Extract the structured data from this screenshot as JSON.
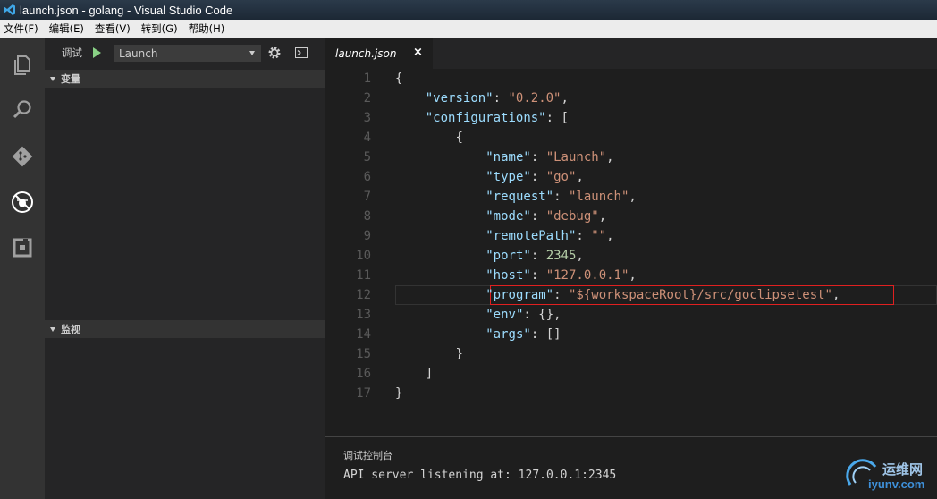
{
  "window": {
    "title": "launch.json - golang - Visual Studio Code"
  },
  "menu": [
    "文件(F)",
    "编辑(E)",
    "查看(V)",
    "转到(G)",
    "帮助(H)"
  ],
  "activity_bar": [
    {
      "icon": "explorer-icon"
    },
    {
      "icon": "search-icon"
    },
    {
      "icon": "git-icon"
    },
    {
      "icon": "debug-icon"
    },
    {
      "icon": "extensions-icon"
    }
  ],
  "debug": {
    "label": "调试",
    "config_selected": "Launch",
    "sections": {
      "variables": "变量",
      "watch": "监视"
    }
  },
  "editor": {
    "tab_label": "launch.json",
    "tab_close": "×",
    "lines": [
      {
        "n": "1",
        "text": "{"
      },
      {
        "n": "2",
        "text": "    \"version\": \"0.2.0\","
      },
      {
        "n": "3",
        "text": "    \"configurations\": ["
      },
      {
        "n": "4",
        "text": "        {"
      },
      {
        "n": "5",
        "text": "            \"name\": \"Launch\","
      },
      {
        "n": "6",
        "text": "            \"type\": \"go\","
      },
      {
        "n": "7",
        "text": "            \"request\": \"launch\","
      },
      {
        "n": "8",
        "text": "            \"mode\": \"debug\","
      },
      {
        "n": "9",
        "text": "            \"remotePath\": \"\","
      },
      {
        "n": "10",
        "text": "            \"port\": 2345,"
      },
      {
        "n": "11",
        "text": "            \"host\": \"127.0.0.1\","
      },
      {
        "n": "12",
        "text": "            \"program\": \"${workspaceRoot}/src/goclipsetest\","
      },
      {
        "n": "13",
        "text": "            \"env\": {},"
      },
      {
        "n": "14",
        "text": "            \"args\": []"
      },
      {
        "n": "15",
        "text": "        }"
      },
      {
        "n": "16",
        "text": "    ]"
      },
      {
        "n": "17",
        "text": "}"
      }
    ]
  },
  "panel": {
    "title": "调试控制台",
    "output": "API server listening at: 127.0.0.1:2345"
  },
  "watermark": {
    "line1": "运维网",
    "line2": "iyunv.com"
  },
  "colors": {
    "accent": "#89d185",
    "highlight": "#e02020",
    "key": "#9cdcfe",
    "string": "#ce9178",
    "number": "#b5cea8"
  }
}
